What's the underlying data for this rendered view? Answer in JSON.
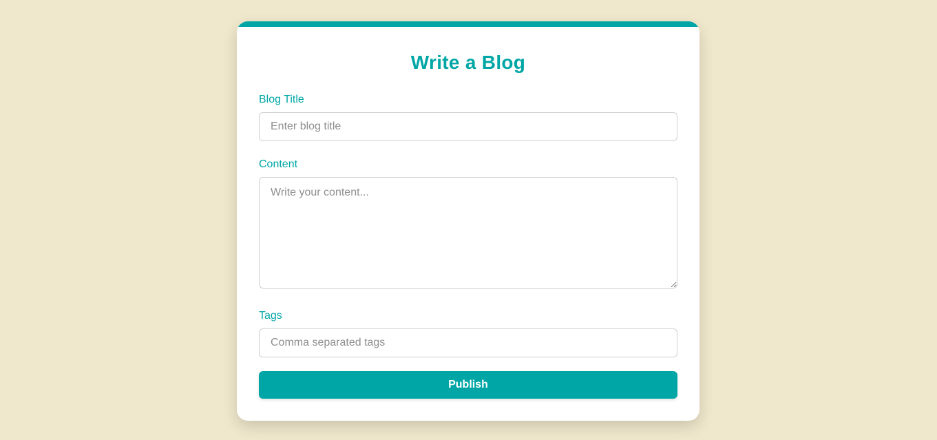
{
  "form": {
    "heading": "Write a Blog",
    "title_field": {
      "label": "Blog Title",
      "placeholder": "Enter blog title",
      "value": ""
    },
    "content_field": {
      "label": "Content",
      "placeholder": "Write your content...",
      "value": ""
    },
    "tags_field": {
      "label": "Tags",
      "placeholder": "Comma separated tags",
      "value": ""
    },
    "submit_label": "Publish"
  },
  "theme": {
    "accent": "#00a6a6",
    "background": "#f0e8cc",
    "card": "#ffffff"
  }
}
